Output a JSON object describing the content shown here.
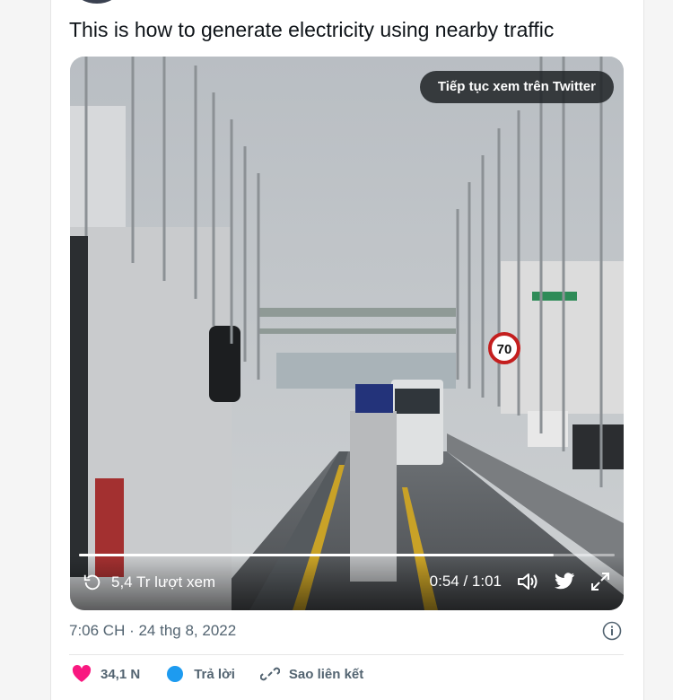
{
  "tweet": {
    "text": "This is how to generate electricity using nearby traffic"
  },
  "media": {
    "continue_label": "Tiếp tục xem trên Twitter",
    "speed_sign": "70",
    "progress": 0.886,
    "views": "5,4 Tr lượt xem",
    "time": "0:54 / 1:01"
  },
  "meta": {
    "timestamp": "7:06 CH · 24 thg 8, 2022"
  },
  "actions": {
    "likes": "34,1 N",
    "reply": "Trả lời",
    "copy_link": "Sao liên kết"
  },
  "colors": {
    "like": "#f91880",
    "reply": "#1d9bf0",
    "text_secondary": "#536471"
  }
}
